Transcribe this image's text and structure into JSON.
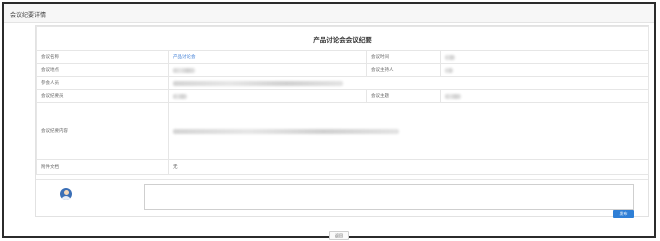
{
  "page": {
    "title": "会议纪要详情"
  },
  "minutes": {
    "heading": "产品讨论会会议纪要",
    "fields": {
      "name_label": "会议名称",
      "name_value": "产品讨论会",
      "time_label": "会议时间",
      "location_label": "会议地点",
      "host_label": "会议主持人",
      "participants_label": "参会人员",
      "recorder_label": "会议纪要员",
      "topic_label": "会议主题",
      "content_label": "会议纪要内容",
      "attachment_label": "附件文档",
      "attachment_value": "无"
    }
  },
  "comment": {
    "placeholder": "",
    "publish_label": "发布"
  },
  "footer": {
    "back_label": "返回"
  },
  "colors": {
    "link": "#3a7bd5",
    "primary_button": "#2f7fd6"
  }
}
